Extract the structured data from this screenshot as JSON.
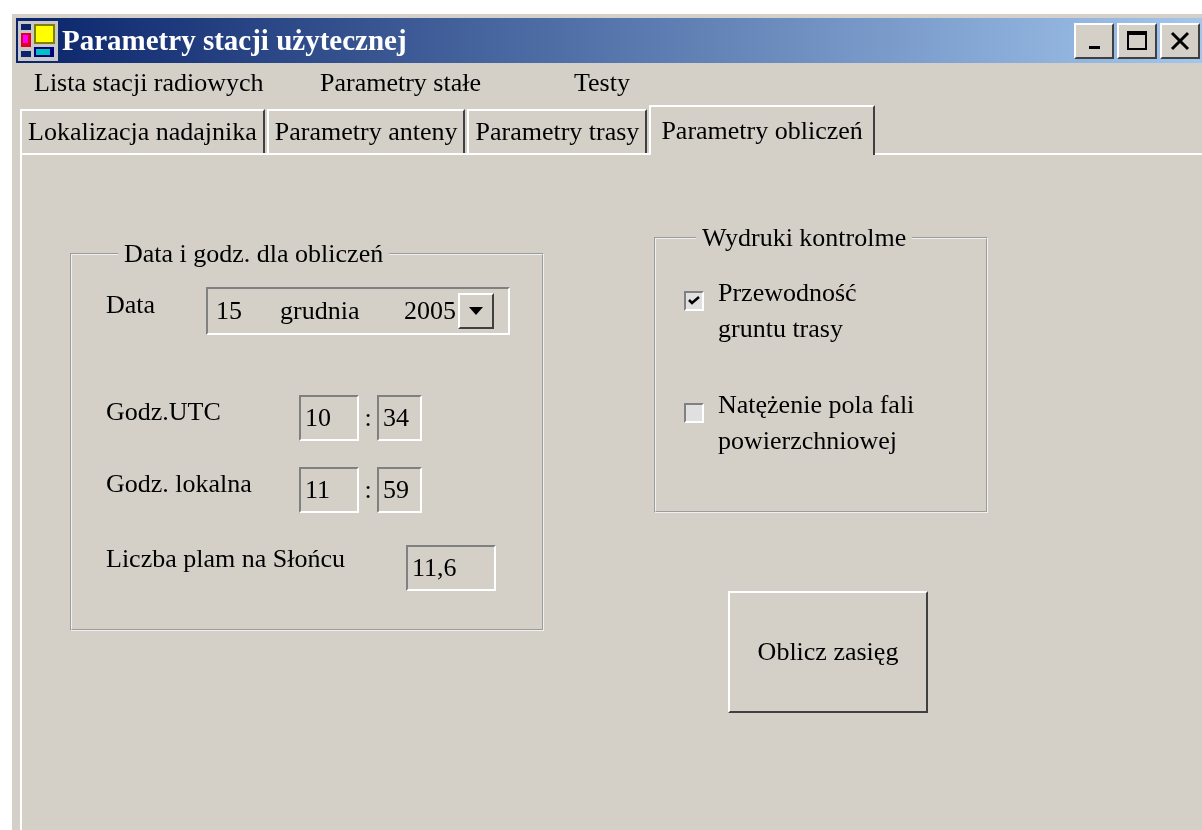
{
  "window": {
    "title": "Parametry stacji użytecznej"
  },
  "menu": [
    {
      "label": "Lista stacji radiowych"
    },
    {
      "label": "Parametry stałe"
    },
    {
      "label": "Testy"
    }
  ],
  "tabs": [
    {
      "label": "Lokalizacja nadajnika",
      "selected": false
    },
    {
      "label": "Parametry anteny",
      "selected": false
    },
    {
      "label": "Parametry trasy",
      "selected": false
    },
    {
      "label": "Parametry obliczeń",
      "selected": true
    }
  ],
  "date_group": {
    "title": "Data i godz. dla obliczeń",
    "date": {
      "label": "Data",
      "day": "15",
      "month": "grudnia",
      "year": "2005"
    },
    "times": [
      {
        "label": "Godz.UTC",
        "hour": "10",
        "separator": ":",
        "minute": "34"
      },
      {
        "label": "Godz. lokalna",
        "hour": "11",
        "separator": ":",
        "minute": "59"
      }
    ],
    "sunspots": {
      "label": "Liczba plam na Słońcu",
      "value": "11,6"
    }
  },
  "printouts": {
    "title": "Wydruki kontrolme",
    "options": [
      {
        "label": "Przewodność\ngruntu trasy",
        "checked": true
      },
      {
        "label": "Natężenie pola fali\npowierzchniowej",
        "checked": false
      }
    ]
  },
  "action_button": "Oblicz zasięg"
}
